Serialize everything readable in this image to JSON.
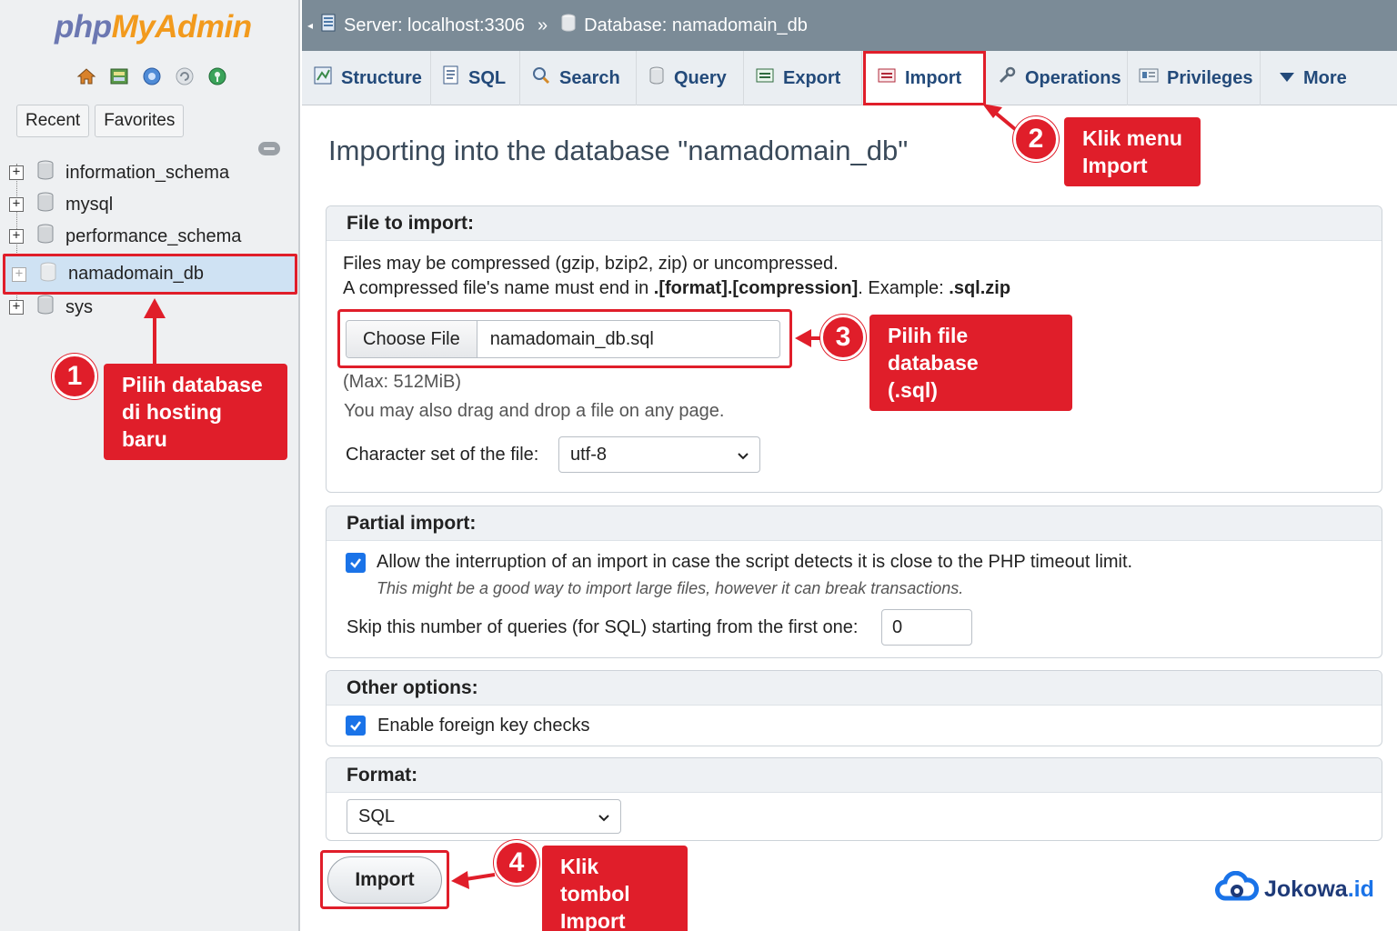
{
  "sidebar": {
    "logo": {
      "php": "php",
      "my": "My",
      "admin": "Admin"
    },
    "quick_icons": [
      "home-icon",
      "database-icon",
      "docs-icon",
      "reload-icon",
      "settings-icon"
    ],
    "tabs": [
      "Recent",
      "Favorites"
    ],
    "databases": [
      {
        "name": "information_schema",
        "selected": false
      },
      {
        "name": "mysql",
        "selected": false
      },
      {
        "name": "performance_schema",
        "selected": false
      },
      {
        "name": "namadomain_db",
        "selected": true
      },
      {
        "name": "sys",
        "selected": false
      }
    ]
  },
  "topbar": {
    "server": "Server: localhost:3306",
    "separator": "»",
    "database": "Database: namadomain_db"
  },
  "tabs": [
    {
      "label": "Structure",
      "icon": "structure-icon"
    },
    {
      "label": "SQL",
      "icon": "sql-icon"
    },
    {
      "label": "Search",
      "icon": "search-icon"
    },
    {
      "label": "Query",
      "icon": "query-icon"
    },
    {
      "label": "Export",
      "icon": "export-icon"
    },
    {
      "label": "Import",
      "icon": "import-icon",
      "active": true
    },
    {
      "label": "Operations",
      "icon": "wrench-icon"
    },
    {
      "label": "Privileges",
      "icon": "privileges-icon"
    },
    {
      "label": "More",
      "icon": "caret-down-icon"
    }
  ],
  "main": {
    "title": "Importing into the database \"namadomain_db\"",
    "file_section": {
      "legend": "File to import:",
      "line1": "Files may be compressed (gzip, bzip2, zip) or uncompressed.",
      "line2_pre": "A compressed file's name must end in ",
      "line2_bold1": ".[format].[compression]",
      "line2_mid": ". Example: ",
      "line2_bold2": ".sql.zip",
      "choose_label": "Choose File",
      "file_name": "namadomain_db.sql",
      "max": "(Max: 512MiB)",
      "drag_hint": "You may also drag and drop a file on any page.",
      "charset_label": "Character set of the file:",
      "charset_value": "utf-8"
    },
    "partial_section": {
      "legend": "Partial import:",
      "allow_label": "Allow the interruption of an import in case the script detects it is close to the PHP timeout limit.",
      "allow_checked": true,
      "allow_hint": "This might be a good way to import large files, however it can break transactions.",
      "skip_label": "Skip this number of queries (for SQL) starting from the first one:",
      "skip_value": "0"
    },
    "other_section": {
      "legend": "Other options:",
      "fk_label": "Enable foreign key checks",
      "fk_checked": true
    },
    "format_section": {
      "legend": "Format:",
      "value": "SQL"
    },
    "import_button": "Import"
  },
  "annotations": {
    "accent": "#e01e2a",
    "steps": [
      {
        "num": "1",
        "text_lines": [
          "Pilih database",
          "di hosting baru"
        ]
      },
      {
        "num": "2",
        "text_lines": [
          "Klik menu",
          "Import"
        ]
      },
      {
        "num": "3",
        "text_lines": [
          "Pilih file database",
          "(.sql)"
        ]
      },
      {
        "num": "4",
        "text_lines": [
          "Klik tombol",
          "Import"
        ]
      }
    ]
  },
  "watermark": {
    "brand": "Jokowa",
    "suffix": ".id"
  }
}
